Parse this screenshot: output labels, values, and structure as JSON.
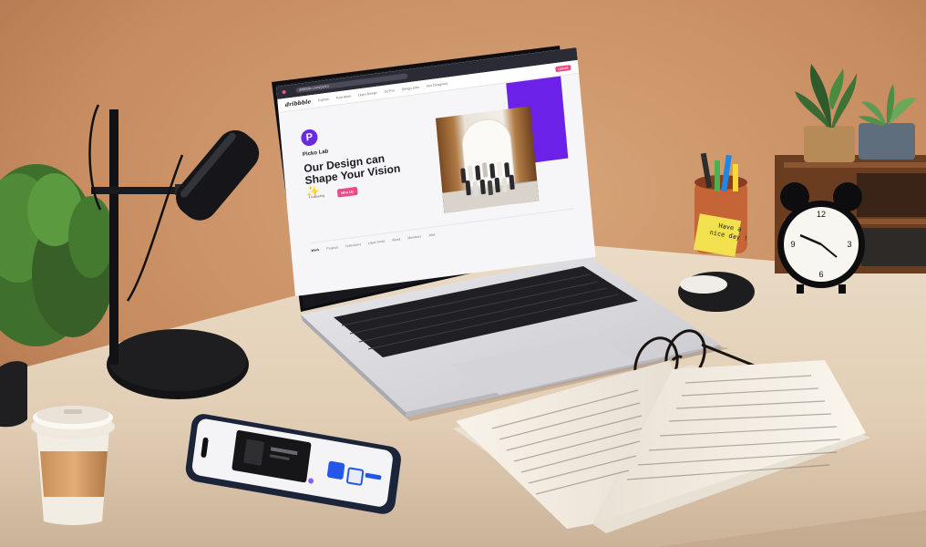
{
  "screen": {
    "browser_url": "dribbble.com/picko",
    "nav_logo": "dribbble",
    "nav_links": [
      "Explore",
      "Find Work",
      "Learn Design",
      "Go Pro",
      "Design Jobs",
      "Hire Designers"
    ],
    "nav_button": "Upload",
    "studio_name": "Picko Lab",
    "headline": "Our Design can Shape Your Vision ✨",
    "follow_label": "+ Following",
    "hire_label": "Hire Us",
    "caption": "Picko Lab",
    "tabs": [
      "Work",
      "Projects",
      "Collections",
      "Liked Shots",
      "About",
      "Members",
      "Jobs"
    ]
  },
  "sticky_note": {
    "text": "Have a nice day !"
  },
  "colors": {
    "wall": "#c98f63",
    "desk": "#e3d2bc",
    "brand_purple": "#6a2be0",
    "dribbble_pink": "#ea4c89"
  }
}
